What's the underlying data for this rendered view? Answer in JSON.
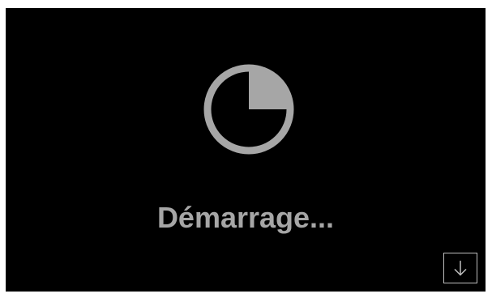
{
  "status": {
    "label": "Démarrage..."
  },
  "progress_icon": {
    "name": "pie-progress-icon",
    "progress_fraction": 0.25,
    "color": "#a6a6a6"
  },
  "corner_button": {
    "icon": "arrow-down-icon",
    "color": "#bdbdbd"
  },
  "colors": {
    "background": "#000000",
    "foreground": "#a6a6a6"
  }
}
